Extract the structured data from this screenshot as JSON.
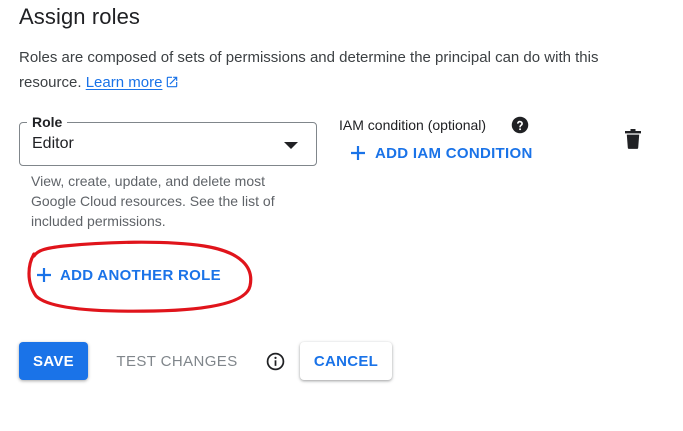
{
  "header": {
    "title": "Assign roles",
    "description": "Roles are composed of sets of permissions and determine the principal can do with this resource.",
    "learn_more": "Learn more",
    "learn_more_icon": "external-link-icon"
  },
  "role": {
    "label": "Role",
    "value": "Editor",
    "helper": "View, create, update, and delete most Google Cloud resources. See the list of included permissions."
  },
  "iam_condition": {
    "label": "IAM condition (optional)",
    "help_icon": "help-icon",
    "add_label": "ADD IAM CONDITION",
    "delete_icon": "trash-icon"
  },
  "add_another_role": "ADD ANOTHER ROLE",
  "actions": {
    "save": "SAVE",
    "test_changes": "TEST CHANGES",
    "info_icon": "info-icon",
    "cancel": "CANCEL"
  },
  "colors": {
    "accent": "#1a73e8",
    "annotation": "#e0141b",
    "disabled_text": "#80868b"
  }
}
